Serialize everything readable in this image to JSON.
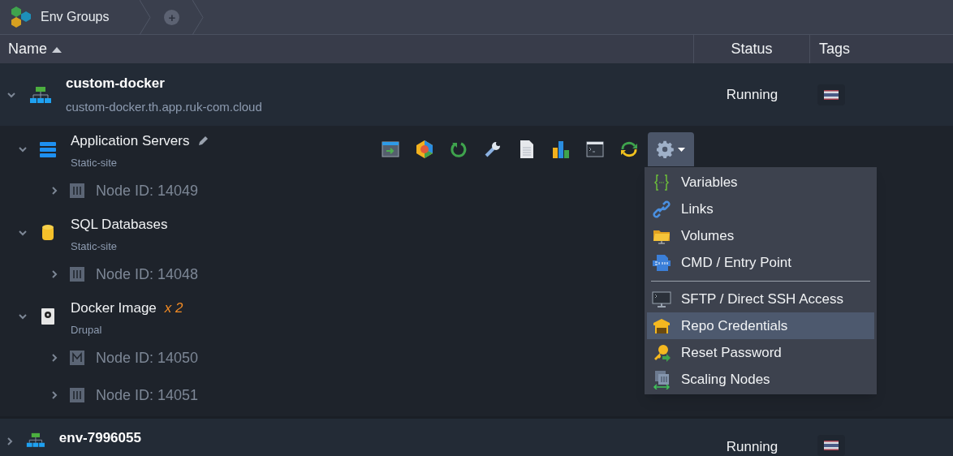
{
  "breadcrumb": {
    "title": "Env Groups",
    "add": "+"
  },
  "columns": [
    {
      "label": "Name",
      "sorted": true
    },
    {
      "label": "Status"
    },
    {
      "label": "Tags"
    }
  ],
  "environments": [
    {
      "name": "custom-docker",
      "domain": "custom-docker.th.app.ruk-com.cloud",
      "status": "Running",
      "expanded": true,
      "groups": [
        {
          "kind": "app",
          "title": "Application Servers",
          "subtitle": "Static-site",
          "editable": true,
          "expanded": true,
          "nodes": [
            {
              "label": "Node ID: 14049",
              "kind": "bars",
              "expanded": false
            }
          ]
        },
        {
          "kind": "db",
          "title": "SQL Databases",
          "subtitle": "Static-site",
          "expanded": true,
          "nodes": [
            {
              "label": "Node ID: 14048",
              "kind": "bars",
              "expanded": false
            }
          ]
        },
        {
          "kind": "docker",
          "title": "Docker Image",
          "count": "x 2",
          "subtitle": "Drupal",
          "expanded": true,
          "nodes": [
            {
              "label": "Node ID: 14050",
              "kind": "m",
              "expanded": false
            },
            {
              "label": "Node ID: 14051",
              "kind": "bars",
              "expanded": false
            }
          ]
        }
      ]
    },
    {
      "name": "env-7996055",
      "status": "Running",
      "expanded": false
    }
  ],
  "menu": {
    "items": [
      {
        "kind": "variables",
        "label": "Variables",
        "selected": false
      },
      {
        "kind": "links",
        "label": "Links",
        "selected": false
      },
      {
        "kind": "volumes",
        "label": "Volumes",
        "selected": false
      },
      {
        "kind": "cmd",
        "label": "CMD / Entry Point",
        "selected": false
      },
      {
        "kind": "separator"
      },
      {
        "kind": "ssh",
        "label": "SFTP / Direct SSH Access",
        "selected": false
      },
      {
        "kind": "repo",
        "label": "Repo Credentials",
        "selected": true
      },
      {
        "kind": "key",
        "label": "Reset Password",
        "selected": false
      },
      {
        "kind": "scaling",
        "label": "Scaling Nodes",
        "selected": false
      }
    ]
  }
}
